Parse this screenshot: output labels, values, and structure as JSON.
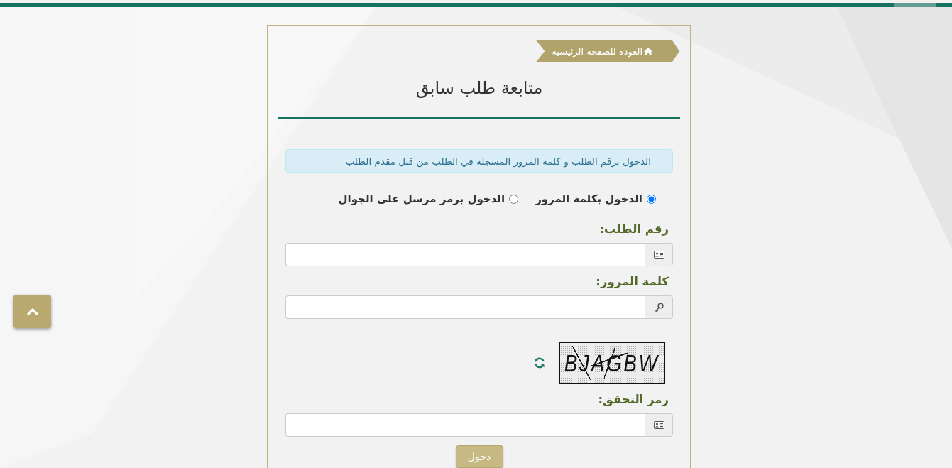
{
  "back_link": {
    "label": "العودة للصفحة الرئيسية"
  },
  "title": "متابعة طلب سابق",
  "notice": "الدخول برقم الطلب و كلمة المرور المسجلة في الطلب من قبل مقدم الطلب",
  "login_methods": [
    {
      "label": "الدخول بكلمة المرور",
      "selected": true
    },
    {
      "label": "الدخول برمز مرسل على الجوال",
      "selected": false
    }
  ],
  "fields": [
    {
      "kind": "text",
      "label": "رقم الطلب:"
    },
    {
      "kind": "password",
      "label": "كلمة المرور:"
    },
    {
      "kind": "captcha",
      "label": "رمز التحقق:",
      "captcha_text": "BJAGBW"
    }
  ],
  "submit_button": "دخول"
}
